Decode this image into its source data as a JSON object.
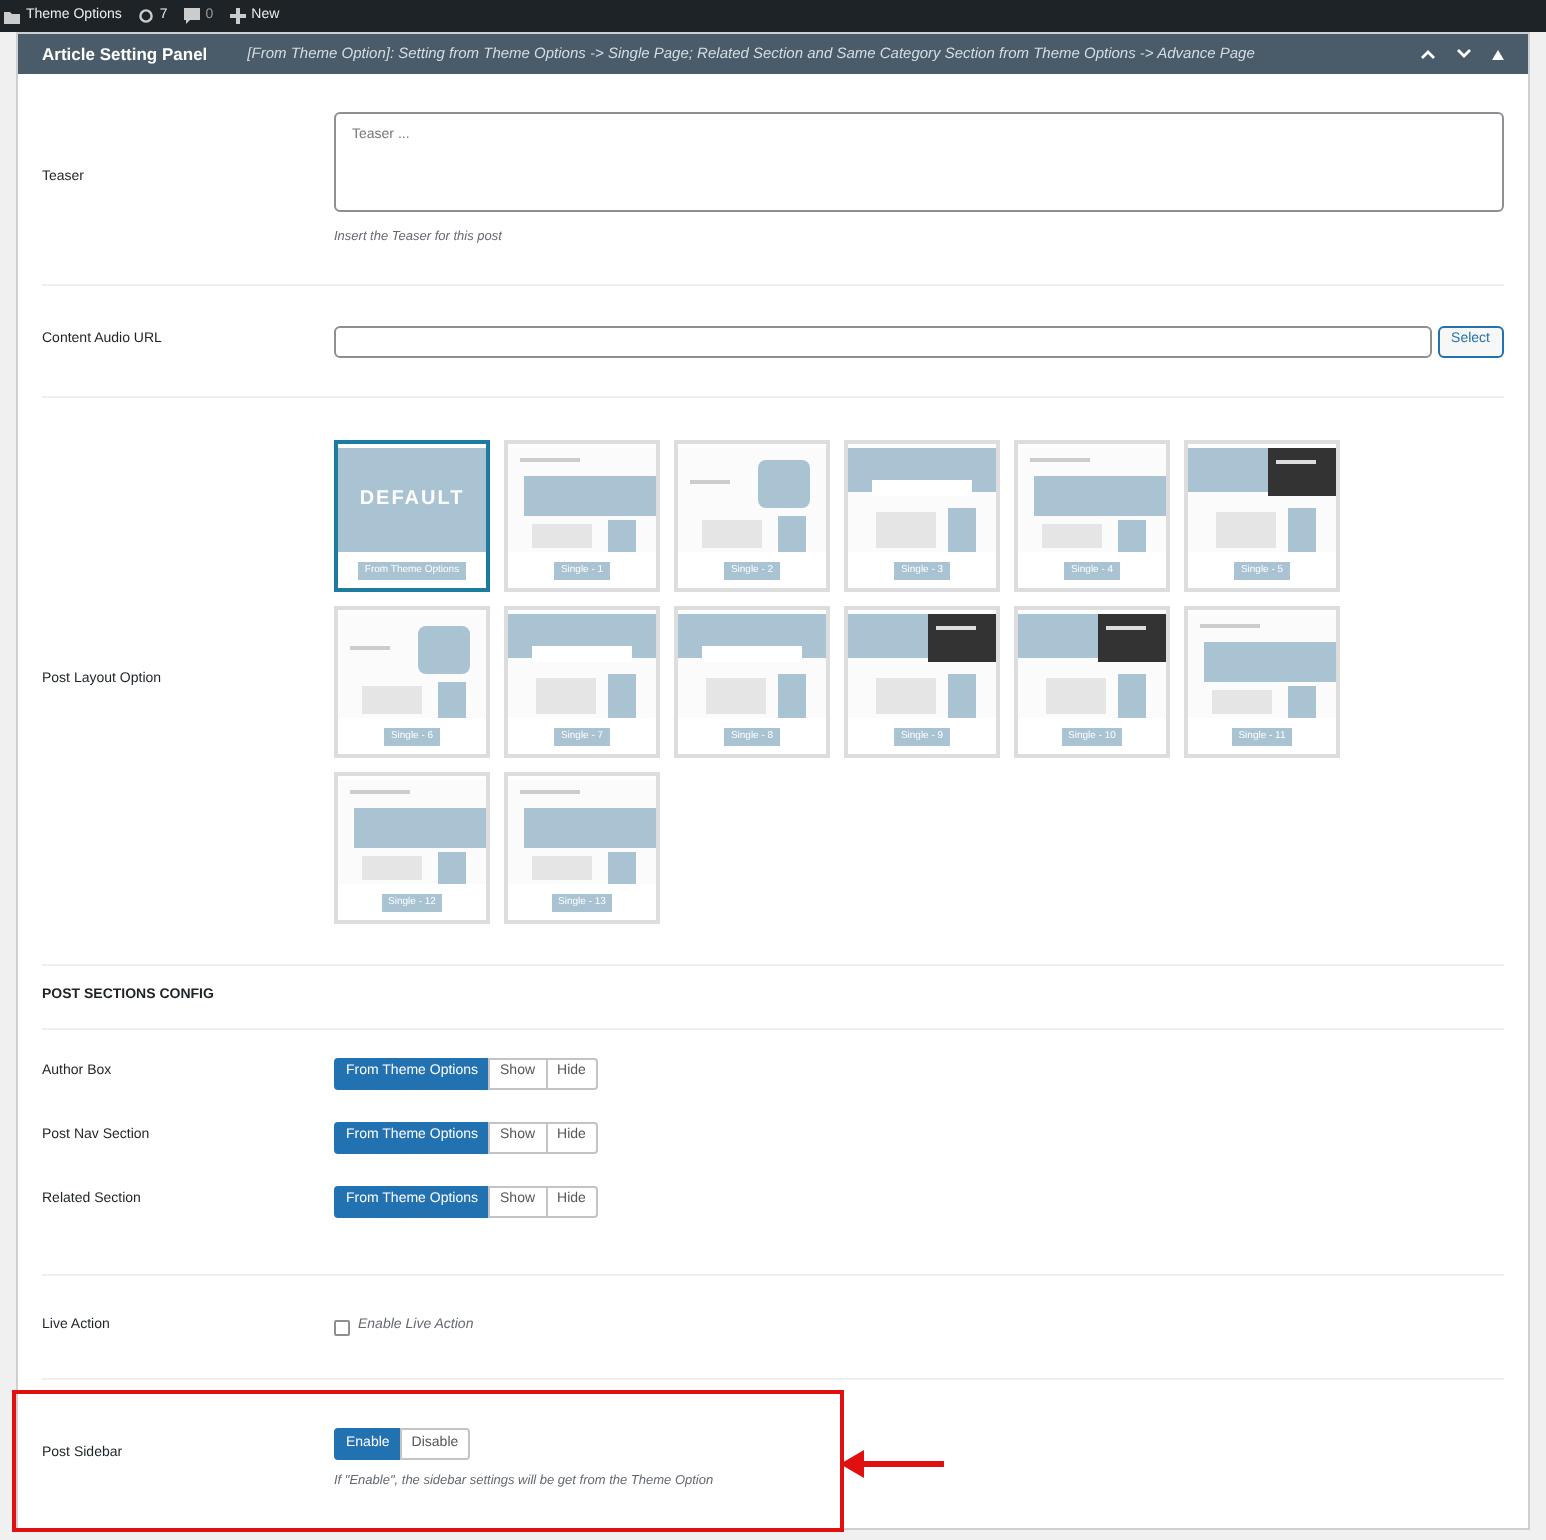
{
  "admin_bar": {
    "site": "Theme Options",
    "updates": "7",
    "comments": "0",
    "new": "New"
  },
  "panel": {
    "title": "Article Setting Panel",
    "description": "[From Theme Option]: Setting from Theme Options -> Single Page; Related Section and Same Category Section from Theme Options -> Advance Page"
  },
  "teaser": {
    "label": "Teaser",
    "placeholder": "Teaser ...",
    "help": "Insert the Teaser for this post"
  },
  "audio": {
    "label": "Content Audio URL",
    "button": "Select"
  },
  "layout": {
    "label": "Post Layout Option",
    "options": [
      {
        "kind": "default",
        "caption": "DEFAULT",
        "label": "From Theme Options",
        "selected": true
      },
      {
        "kind": "wide",
        "label": "Single - 1",
        "selected": false
      },
      {
        "kind": "side",
        "label": "Single - 2",
        "selected": false
      },
      {
        "kind": "top",
        "label": "Single - 3",
        "selected": false
      },
      {
        "kind": "wide",
        "label": "Single - 4",
        "selected": false
      },
      {
        "kind": "dark",
        "label": "Single - 5",
        "selected": false
      },
      {
        "kind": "side",
        "label": "Single - 6",
        "selected": false
      },
      {
        "kind": "top",
        "label": "Single - 7",
        "selected": false
      },
      {
        "kind": "top",
        "label": "Single - 8",
        "selected": false
      },
      {
        "kind": "dark",
        "label": "Single - 9",
        "selected": false
      },
      {
        "kind": "dark",
        "label": "Single - 10",
        "selected": false
      },
      {
        "kind": "wide",
        "label": "Single - 11",
        "selected": false
      },
      {
        "kind": "wide",
        "label": "Single - 12",
        "selected": false
      },
      {
        "kind": "wide",
        "label": "Single - 13",
        "selected": false
      }
    ]
  },
  "sections_config": {
    "heading": "POST SECTIONS CONFIG",
    "rows": [
      {
        "label": "Author Box",
        "options": [
          {
            "label": "From Theme Options",
            "selected": true
          },
          {
            "label": "Show",
            "selected": false
          },
          {
            "label": "Hide",
            "selected": false
          }
        ]
      },
      {
        "label": "Post Nav Section",
        "options": [
          {
            "label": "From Theme Options",
            "selected": true
          },
          {
            "label": "Show",
            "selected": false
          },
          {
            "label": "Hide",
            "selected": false
          }
        ]
      },
      {
        "label": "Related Section",
        "options": [
          {
            "label": "From Theme Options",
            "selected": true
          },
          {
            "label": "Show",
            "selected": false
          },
          {
            "label": "Hide",
            "selected": false
          }
        ]
      }
    ]
  },
  "live_action": {
    "label": "Live Action",
    "option": "Enable Live Action",
    "checked": false
  },
  "post_sidebar": {
    "label": "Post Sidebar",
    "options": [
      {
        "label": "Enable",
        "selected": true
      },
      {
        "label": "Disable",
        "selected": false
      }
    ],
    "help": "If \"Enable\", the sidebar settings will be get from the Theme Option"
  }
}
